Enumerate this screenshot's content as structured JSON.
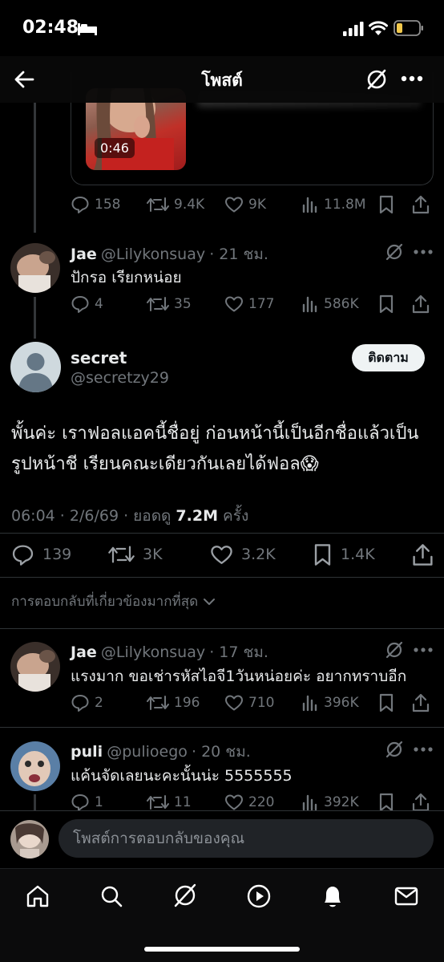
{
  "status_bar": {
    "time": "02:48"
  },
  "header": {
    "title": "โพสต์"
  },
  "quoted_media": {
    "duration": "0:46"
  },
  "parent_post": {
    "stats": {
      "replies": "158",
      "reposts": "9.4K",
      "likes": "9K",
      "views": "11.8M"
    }
  },
  "thread_reply": {
    "name": "Jae",
    "handle": "@Lilykonsuay",
    "time": "· 21 ชม.",
    "text": "ปักรอ เรียกหน่อย",
    "stats": {
      "replies": "4",
      "reposts": "35",
      "likes": "177",
      "views": "586K"
    }
  },
  "main_post": {
    "name": "secret",
    "handle": "@secretzy29",
    "follow_label": "ติดตาม",
    "text": "พั้นค่ะ เราฟอลแอคนี้ชื่อยู่ ก่อนหน้านี้เป็นอีกชื่อแล้วเป็นรูปหน้าชี เรียนคณะเดียวกันเลยได้ฟอล😱",
    "meta_prefix": "06:04 · 2/6/69 · ยอดดู ",
    "views": "7.2M",
    "meta_suffix": " ครั้ง",
    "stats": {
      "replies": "139",
      "reposts": "3K",
      "likes": "3.2K",
      "bookmarks": "1.4K"
    }
  },
  "replies_filter": {
    "label": "การตอบกลับที่เกี่ยวข้องมากที่สุด"
  },
  "replies": [
    {
      "name": "Jae",
      "handle": "@Lilykonsuay",
      "time": "· 17 ชม.",
      "text": "แรงมาก ขอเช่ารหัสไอจี1วันหน่อยค่ะ อยากทราบอีก",
      "stats": {
        "replies": "2",
        "reposts": "196",
        "likes": "710",
        "views": "396K"
      }
    },
    {
      "name": "puli",
      "handle": "@pulioego",
      "time": "· 20 ชม.",
      "text": "แค้นจัดเลยนะคะนั้นน่ะ 5555555",
      "stats": {
        "replies": "1",
        "reposts": "11",
        "likes": "220",
        "views": "392K"
      }
    }
  ],
  "composer": {
    "placeholder": "โพสต์การตอบกลับของคุณ"
  },
  "tab_bar": {
    "items": [
      "home-icon",
      "search-icon",
      "grok-icon",
      "video-icon",
      "notifications-icon",
      "messages-icon"
    ]
  },
  "colors": {
    "background": "#000000",
    "text": "#e7e9ea",
    "muted": "#71767b",
    "divider": "#2f3336"
  }
}
